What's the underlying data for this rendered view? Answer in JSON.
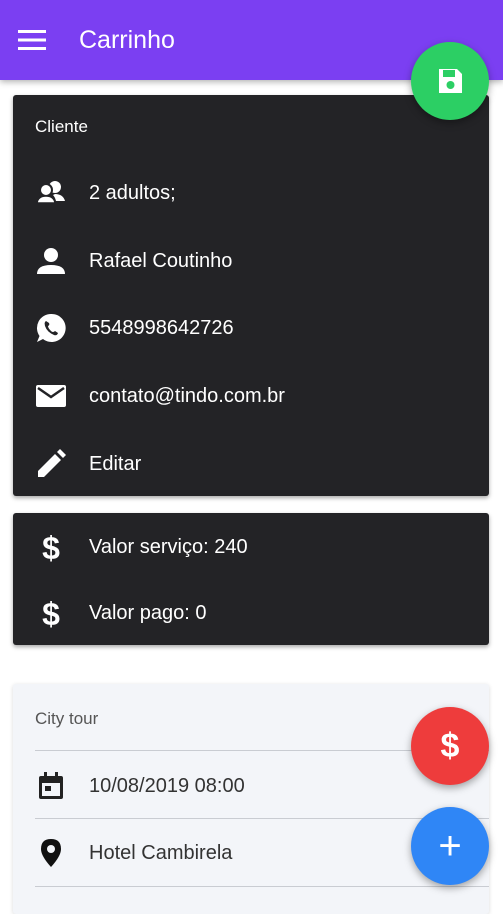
{
  "appbar": {
    "title": "Carrinho",
    "menu_icon": "menu-icon"
  },
  "fabs": {
    "save_icon": "floppy-disk-icon",
    "payment_label": "$",
    "add_label": "+"
  },
  "client": {
    "section_title": "Cliente",
    "guests": "2 adultos;",
    "name": "Rafael Coutinho",
    "phone": "5548998642726",
    "email": "contato@tindo.com.br",
    "edit_label": "Editar"
  },
  "values": {
    "service": "Valor serviço: 240",
    "paid": "Valor pago: 0"
  },
  "tour": {
    "section_title": "City tour",
    "datetime": "10/08/2019 08:00",
    "location": "Hotel Cambirela"
  },
  "colors": {
    "appbar": "#7b3ff2",
    "card_dark": "#232326",
    "save_fab": "#2ccf64",
    "payment_fab": "#ee3c3c",
    "add_fab": "#2f86f6"
  }
}
